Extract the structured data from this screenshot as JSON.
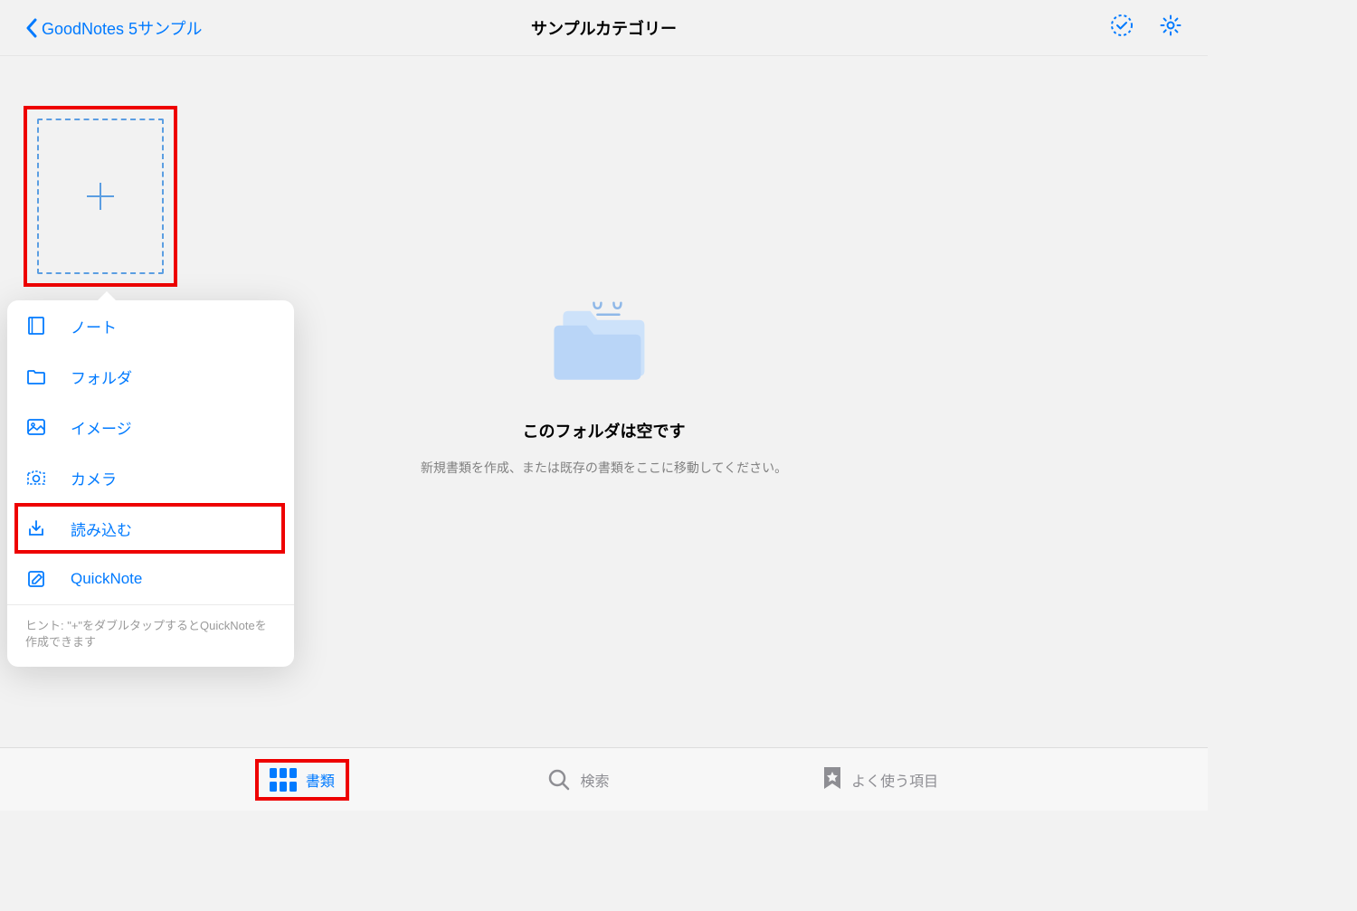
{
  "header": {
    "back_label": "GoodNotes 5サンプル",
    "title": "サンプルカテゴリー"
  },
  "popover": {
    "items": [
      {
        "label": "ノート",
        "icon": "notebook-icon"
      },
      {
        "label": "フォルダ",
        "icon": "folder-icon"
      },
      {
        "label": "イメージ",
        "icon": "image-icon"
      },
      {
        "label": "カメラ",
        "icon": "camera-icon"
      },
      {
        "label": "読み込む",
        "icon": "import-icon"
      },
      {
        "label": "QuickNote",
        "icon": "quicknote-icon"
      }
    ],
    "hint": "ヒント: \"+\"をダブルタップするとQuickNoteを作成できます"
  },
  "empty": {
    "title": "このフォルダは空です",
    "subtitle": "新規書類を作成、または既存の書類をここに移動してください。"
  },
  "tabbar": {
    "documents": "書類",
    "search": "検索",
    "favorites": "よく使う項目"
  },
  "colors": {
    "accent": "#007aff",
    "highlight": "#ee0000"
  }
}
